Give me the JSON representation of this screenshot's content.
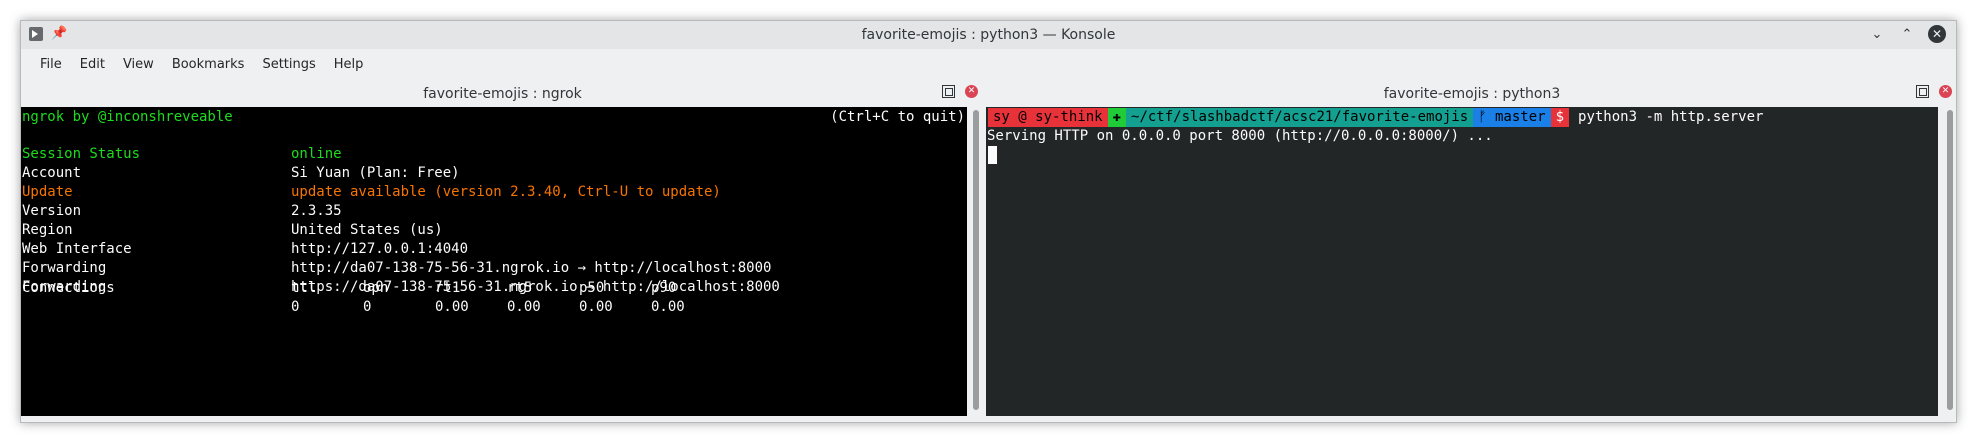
{
  "window": {
    "title": "favorite-emojis : python3 — Konsole",
    "pin_icon": "pin-icon",
    "app_icon": "konsole-icon"
  },
  "menu": [
    "File",
    "Edit",
    "View",
    "Bookmarks",
    "Settings",
    "Help"
  ],
  "left_pane": {
    "title": "favorite-emojis : ngrok",
    "header": {
      "prefix": "ngrok by ",
      "author": "@inconshreveable",
      "quit": "(Ctrl+C to quit)"
    },
    "rows": [
      {
        "key": "Session Status",
        "value": "online",
        "color": "#1cdc1c"
      },
      {
        "key": "Account",
        "value": "Si Yuan (Plan: Free)",
        "color": "#fcfcfc"
      },
      {
        "key": "Update",
        "value": "update available (version 2.3.40, Ctrl-U to update)",
        "color": "#f67400"
      },
      {
        "key": "Version",
        "value": "2.3.35",
        "color": "#fcfcfc"
      },
      {
        "key": "Region",
        "value": "United States (us)",
        "color": "#fcfcfc"
      },
      {
        "key": "Web Interface",
        "value": "http://127.0.0.1:4040",
        "color": "#fcfcfc"
      },
      {
        "key": "Forwarding",
        "value": "http://da07-138-75-56-31.ngrok.io → http://localhost:8000",
        "color": "#fcfcfc"
      },
      {
        "key": "Forwarding",
        "value": "https://da07-138-75-56-31.ngrok.io → http://localhost:8000",
        "color": "#fcfcfc"
      }
    ],
    "connections": {
      "label": "Connections",
      "headers": [
        "ttl",
        "opn",
        "rt1",
        "rt5",
        "p50",
        "p90"
      ],
      "values": [
        "0",
        "0",
        "0.00",
        "0.00",
        "0.00",
        "0.00"
      ]
    }
  },
  "right_pane": {
    "title": "favorite-emojis : python3",
    "prompt": {
      "user": "sy @ sy-think",
      "status": "✚",
      "dir": "~/ctf/slashbadctf/acsc21/favorite-emojis",
      "git": "ᚠ master",
      "dollar": "$",
      "command": "python3 -m http.server"
    },
    "output": "Serving HTTP on 0.0.0.0 port 8000 (http://0.0.0.0:8000/) ..."
  }
}
